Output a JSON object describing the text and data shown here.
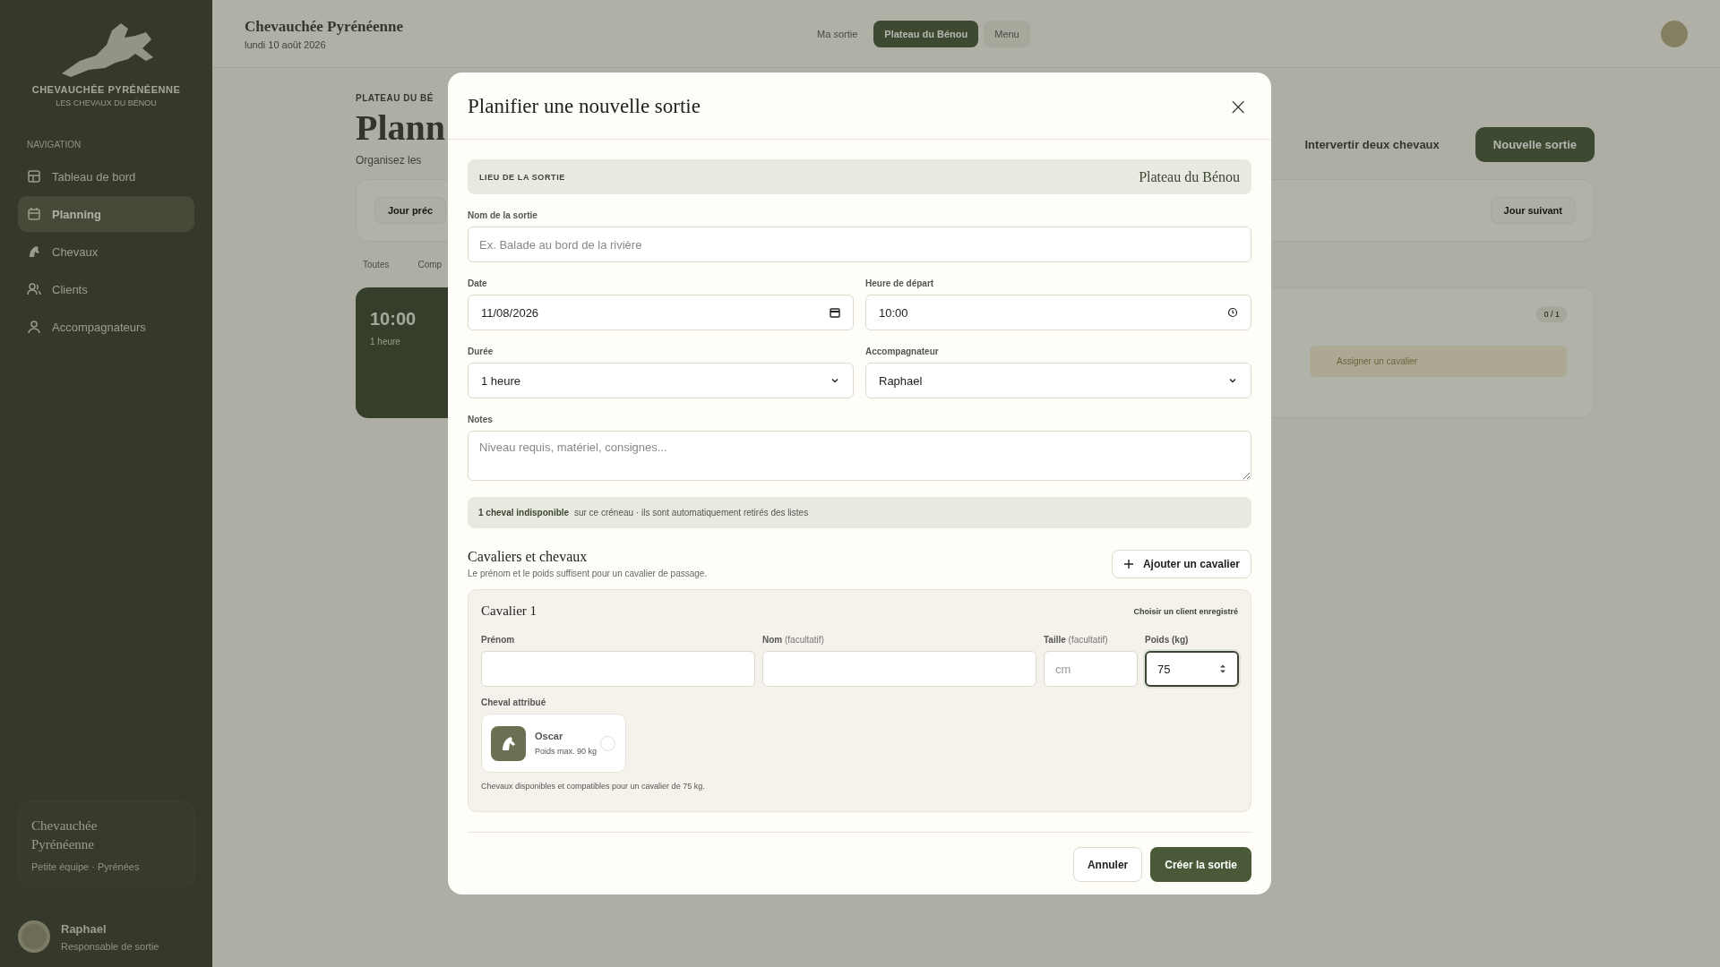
{
  "sidebar": {
    "brand": "CHEVAUCHÉE PYRÉNÉENNE",
    "tagline": "LES CHEVAUX DU BÉNOU",
    "nav_heading": "NAVIGATION",
    "items": [
      {
        "label": "Tableau de bord",
        "selected": false
      },
      {
        "label": "Planning",
        "selected": true
      },
      {
        "label": "Chevaux",
        "selected": false
      },
      {
        "label": "Clients",
        "selected": false
      },
      {
        "label": "Accompagnateurs",
        "selected": false
      }
    ],
    "card": {
      "title": "Chevauchée Pyrénéenne",
      "subtitle": "Petite équipe · Pyrénées"
    },
    "user": {
      "name": "Raphael",
      "role": "Responsable de sortie"
    }
  },
  "header": {
    "title": "Chevauchée Pyrénéenne",
    "date": "lundi 10 août 2026",
    "switcher": [
      {
        "label": "Ma sortie",
        "selected": false
      },
      {
        "label": "Plateau du Bénou",
        "selected": true
      },
      {
        "label": "Menu",
        "selected": false
      }
    ]
  },
  "page": {
    "eyebrow": "PLATEAU DU BÉ",
    "title": "Plann",
    "subtitle": "Organisez les",
    "actions": [
      {
        "label": "Intervertir deux chevaux",
        "kind": "secondary"
      },
      {
        "label": "Nouvelle sortie",
        "kind": "primary"
      }
    ],
    "day_nav": {
      "previous": "Jour préc",
      "next": "Jour suivant"
    },
    "filters": [
      "Toutes",
      "Comp"
    ],
    "outing": {
      "time": "10:00",
      "duration": "1 heure",
      "badge": "0 / 1",
      "assign": "Assigner un cavalier"
    }
  },
  "modal": {
    "title": "Planifier une nouvelle sortie",
    "close": "×",
    "location": {
      "label": "LIEU DE LA SORTIE",
      "value": "Plateau du Bénou"
    },
    "name": {
      "label": "Nom de la sortie",
      "placeholder": "Ex. Balade au bord de la rivière"
    },
    "date": {
      "label": "Date",
      "value": "11/08/2026"
    },
    "start": {
      "label": "Heure de départ",
      "value": "10:00"
    },
    "duration": {
      "label": "Durée",
      "value": "1 heure"
    },
    "guide": {
      "label": "Accompagnateur",
      "value": "Raphael"
    },
    "notes": {
      "label": "Notes",
      "placeholder": "Niveau requis, matériel, consignes..."
    },
    "alert": {
      "strong": "1 cheval indisponible",
      "text": "sur ce créneau · ils sont automatiquement retirés des listes"
    },
    "riders_title": "Cavaliers et chevaux",
    "riders_hint": "Le prénom et le poids suffisent pour un cavalier de passage.",
    "add_rider": "Ajouter un cavalier",
    "riders": [
      {
        "title": "Cavalier 1",
        "pick_client": "Choisir un client enregistré",
        "fields": [
          {
            "label": "Prénom",
            "focused": false
          },
          {
            "label": "Nom",
            "optional": "(facultatif)",
            "focused": false
          },
          {
            "label": "Taille",
            "optional": "(facultatif)",
            "placeholder": "cm",
            "focused": false
          },
          {
            "label": "Poids (kg)",
            "value": "75",
            "focused": true,
            "kind": "number"
          }
        ],
        "horse_label": "Cheval attribué",
        "horses": [
          {
            "name": "Oscar",
            "max": "Poids max. 90 kg",
            "selected": false
          }
        ],
        "horse_hint": "Chevaux disponibles et compatibles pour un cavalier de 75 kg."
      }
    ],
    "cancel": "Annuler",
    "submit": "Créer la sortie"
  }
}
